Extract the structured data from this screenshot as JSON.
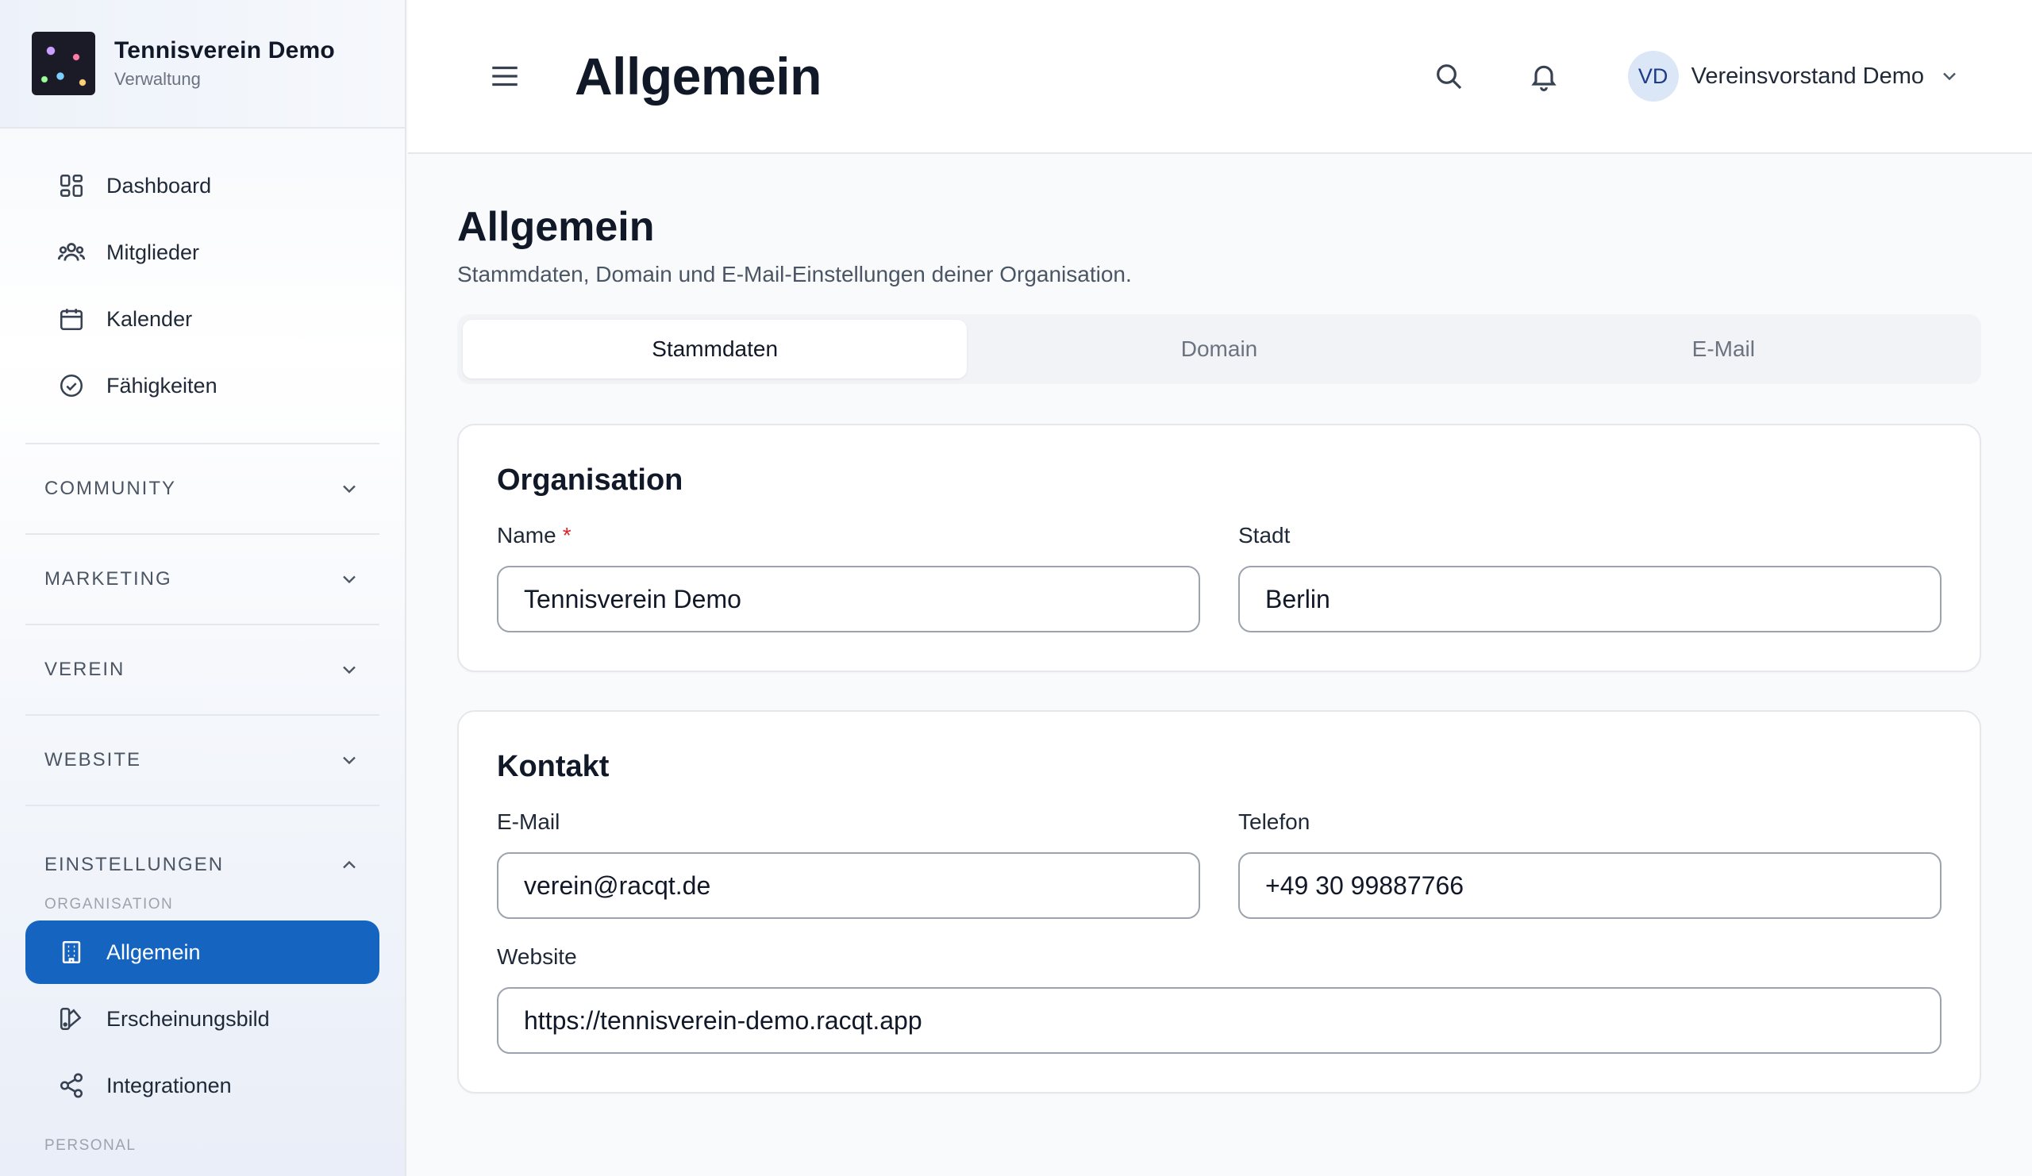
{
  "brand": {
    "title": "Tennisverein Demo",
    "subtitle": "Verwaltung"
  },
  "nav": {
    "items": [
      {
        "label": "Dashboard",
        "icon": "dashboard-icon"
      },
      {
        "label": "Mitglieder",
        "icon": "users-icon"
      },
      {
        "label": "Kalender",
        "icon": "calendar-icon"
      },
      {
        "label": "Fähigkeiten",
        "icon": "check-circle-icon"
      }
    ],
    "sections": [
      {
        "label": "COMMUNITY",
        "expanded": false
      },
      {
        "label": "MARKETING",
        "expanded": false
      },
      {
        "label": "VEREIN",
        "expanded": false
      },
      {
        "label": "WEBSITE",
        "expanded": false
      },
      {
        "label": "EINSTELLUNGEN",
        "expanded": true
      }
    ],
    "settings": {
      "group_organisation": "ORGANISATION",
      "items": [
        {
          "label": "Allgemein",
          "icon": "building-icon",
          "active": true
        },
        {
          "label": "Erscheinungsbild",
          "icon": "palette-icon",
          "active": false
        },
        {
          "label": "Integrationen",
          "icon": "share-icon",
          "active": false
        }
      ],
      "group_personal": "PERSONAL"
    }
  },
  "header": {
    "title": "Allgemein",
    "user": {
      "initials": "VD",
      "name": "Vereinsvorstand Demo"
    }
  },
  "page": {
    "title": "Allgemein",
    "description": "Stammdaten, Domain und E-Mail-Einstellungen deiner Organisation.",
    "tabs": [
      {
        "label": "Stammdaten",
        "active": true
      },
      {
        "label": "Domain",
        "active": false
      },
      {
        "label": "E-Mail",
        "active": false
      }
    ]
  },
  "organisation": {
    "title": "Organisation",
    "name_label": "Name",
    "required_mark": "*",
    "name_value": "Tennisverein Demo",
    "city_label": "Stadt",
    "city_value": "Berlin"
  },
  "contact": {
    "title": "Kontakt",
    "email_label": "E-Mail",
    "email_value": "verein@racqt.de",
    "phone_label": "Telefon",
    "phone_value": "+49 30 99887766",
    "website_label": "Website",
    "website_value": "https://tennisverein-demo.racqt.app"
  },
  "colors": {
    "accent": "#1565c0",
    "required": "#dc2626"
  }
}
